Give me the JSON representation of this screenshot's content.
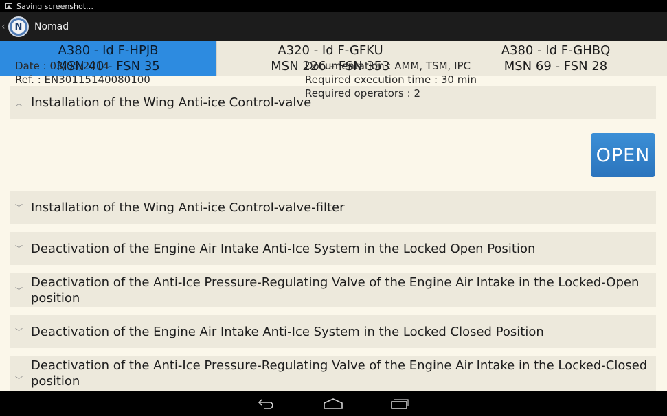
{
  "status_bar": {
    "text": "Saving screenshot…"
  },
  "action_bar": {
    "logo_letter": "N",
    "title": "Nomad"
  },
  "tabs": [
    {
      "line1": "A380 - Id F-HPJB",
      "line2": "MSN 40 - FSN 35",
      "selected": true
    },
    {
      "line1": "A320 - Id F-GFKU",
      "line2": "MSN 226 - FSN 353",
      "selected": false
    },
    {
      "line1": "A380 - Id F-GHBQ",
      "line2": "MSN 69 - FSN 28",
      "selected": false
    }
  ],
  "procedures": [
    {
      "title": "Installation of the Wing Anti-ice Control-valve",
      "expanded": true
    },
    {
      "title": "Installation of the Wing Anti-ice Control-valve-filter",
      "expanded": false
    },
    {
      "title": "Deactivation of the Engine Air Intake Anti-Ice System in the Locked Open Position",
      "expanded": false
    },
    {
      "title": "Deactivation of the Anti-Ice Pressure-Regulating Valve of the Engine Air Intake in the Locked-Open position",
      "expanded": false
    },
    {
      "title": "Deactivation of the Engine Air Intake Anti-Ice System in the Locked Closed Position",
      "expanded": false
    },
    {
      "title": "Deactivation of the Anti-Ice Pressure-Regulating Valve of the Engine Air Intake in the Locked-Closed position",
      "expanded": false
    }
  ],
  "details": {
    "date": "Date : 03/05/2014",
    "ref": "Ref. : EN30115140080100",
    "documentation": "Documentation : AMM, TSM, IPC",
    "exec_time": "Required execution time : 30 min",
    "operators": "Required operators : 2",
    "open_label": "OPEN"
  },
  "icons": {
    "up": "chevron-left-icon",
    "expanded": "chevron-up-icon",
    "collapsed": "chevron-down-icon",
    "back": "back-icon",
    "home": "home-icon",
    "recent": "recent-apps-icon"
  },
  "colors": {
    "selected_tab": "#2d8be0",
    "open_button": "#3b8fd6",
    "background": "#fbf7ea",
    "row": "#ede9dc"
  }
}
